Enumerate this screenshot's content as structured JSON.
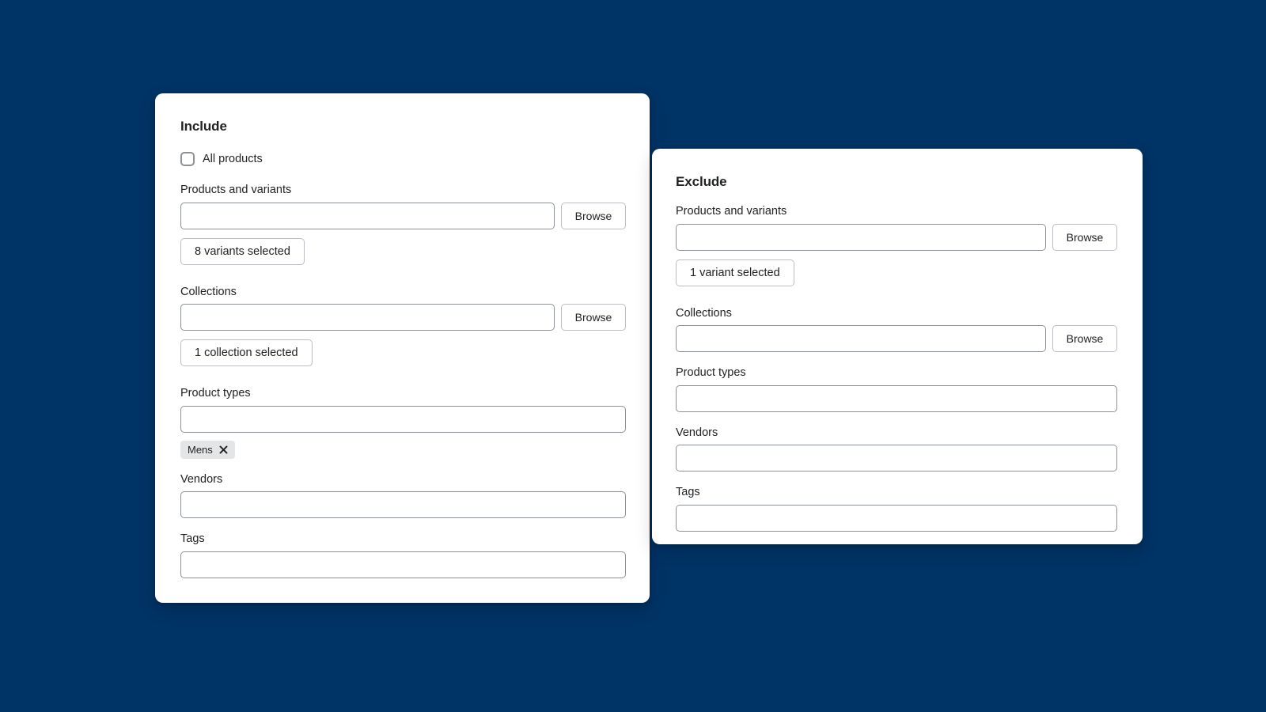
{
  "theme": {
    "background_color": "#003366",
    "card_background": "#ffffff",
    "text_color": "#202223",
    "input_border_color": "#8c9196",
    "button_border_color": "#babec3",
    "chip_background": "#e4e5e7"
  },
  "include_card": {
    "title": "Include",
    "all_products_checkbox": {
      "label": "All products",
      "checked": false
    },
    "fields": {
      "products_and_variants": {
        "label": "Products and variants",
        "value": "",
        "placeholder": "",
        "browse_label": "Browse",
        "selection_summary": "8 variants selected"
      },
      "collections": {
        "label": "Collections",
        "value": "",
        "placeholder": "",
        "browse_label": "Browse",
        "selection_summary": "1 collection selected"
      },
      "product_types": {
        "label": "Product types",
        "value": "",
        "placeholder": "",
        "chips": [
          {
            "label": "Mens",
            "remove_icon": "close-icon"
          }
        ]
      },
      "vendors": {
        "label": "Vendors",
        "value": "",
        "placeholder": ""
      },
      "tags": {
        "label": "Tags",
        "value": "",
        "placeholder": ""
      }
    }
  },
  "exclude_card": {
    "title": "Exclude",
    "fields": {
      "products_and_variants": {
        "label": "Products and variants",
        "value": "",
        "placeholder": "",
        "browse_label": "Browse",
        "selection_summary": "1 variant selected"
      },
      "collections": {
        "label": "Collections",
        "value": "",
        "placeholder": "",
        "browse_label": "Browse"
      },
      "product_types": {
        "label": "Product types",
        "value": "",
        "placeholder": ""
      },
      "vendors": {
        "label": "Vendors",
        "value": "",
        "placeholder": ""
      },
      "tags": {
        "label": "Tags",
        "value": "",
        "placeholder": ""
      }
    }
  }
}
